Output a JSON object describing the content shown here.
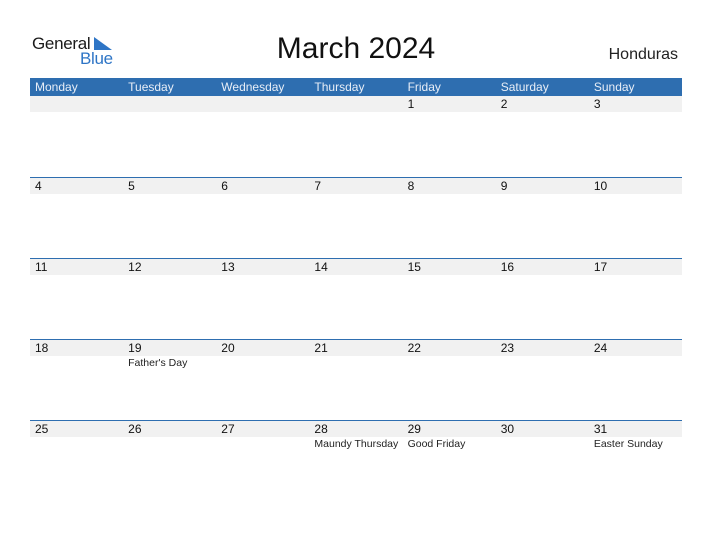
{
  "brand": {
    "word1": "General",
    "word2": "Blue",
    "accent": "#2e75c6"
  },
  "title": "March 2024",
  "country": "Honduras",
  "header_color": "#2e6eb0",
  "weekdays": [
    "Monday",
    "Tuesday",
    "Wednesday",
    "Thursday",
    "Friday",
    "Saturday",
    "Sunday"
  ],
  "weeks": [
    {
      "days": [
        "",
        "",
        "",
        "",
        "1",
        "2",
        "3"
      ],
      "events": [
        "",
        "",
        "",
        "",
        "",
        "",
        ""
      ]
    },
    {
      "days": [
        "4",
        "5",
        "6",
        "7",
        "8",
        "9",
        "10"
      ],
      "events": [
        "",
        "",
        "",
        "",
        "",
        "",
        ""
      ]
    },
    {
      "days": [
        "11",
        "12",
        "13",
        "14",
        "15",
        "16",
        "17"
      ],
      "events": [
        "",
        "",
        "",
        "",
        "",
        "",
        ""
      ]
    },
    {
      "days": [
        "18",
        "19",
        "20",
        "21",
        "22",
        "23",
        "24"
      ],
      "events": [
        "",
        "Father's Day",
        "",
        "",
        "",
        "",
        ""
      ]
    },
    {
      "days": [
        "25",
        "26",
        "27",
        "28",
        "29",
        "30",
        "31"
      ],
      "events": [
        "",
        "",
        "",
        "Maundy Thursday",
        "Good Friday",
        "",
        "Easter Sunday"
      ]
    }
  ]
}
